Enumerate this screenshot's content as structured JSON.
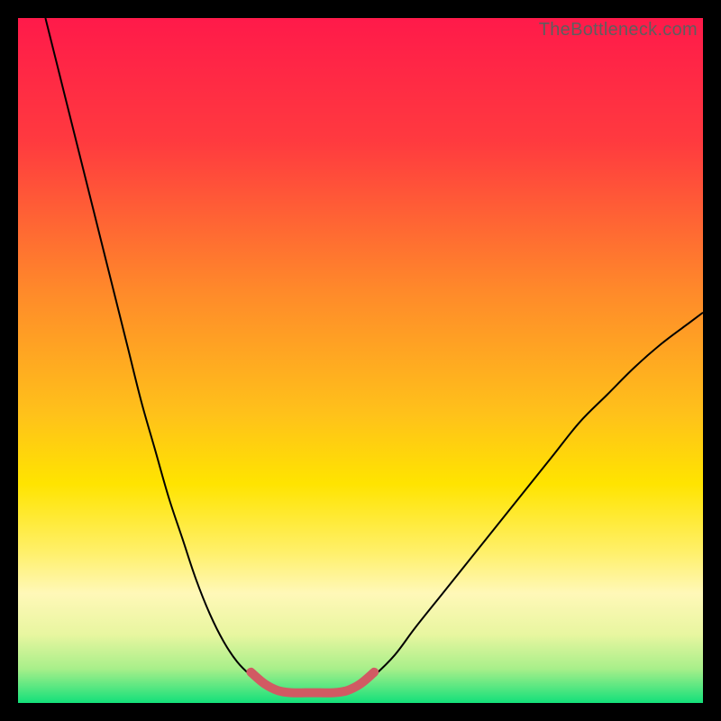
{
  "watermark": "TheBottleneck.com",
  "chart_data": {
    "type": "line",
    "title": "",
    "xlabel": "",
    "ylabel": "",
    "xlim": [
      0,
      100
    ],
    "ylim": [
      0,
      100
    ],
    "grid": false,
    "legend": false,
    "background_gradient": {
      "top_color": "#ff1a4a",
      "mid_color": "#ffe400",
      "bottom_color": "#13e07a",
      "stops": [
        {
          "pos": 0.0,
          "color": "#ff1a4a"
        },
        {
          "pos": 0.4,
          "color": "#ff8a2a"
        },
        {
          "pos": 0.68,
          "color": "#ffe400"
        },
        {
          "pos": 0.8,
          "color": "#fff59a"
        },
        {
          "pos": 0.92,
          "color": "#c9f27a"
        },
        {
          "pos": 1.0,
          "color": "#13e07a"
        }
      ]
    },
    "series": [
      {
        "name": "left-curve",
        "stroke": "#000000",
        "stroke_width": 2,
        "x": [
          4,
          6,
          8,
          10,
          12,
          14,
          16,
          18,
          20,
          22,
          24,
          26,
          28,
          30,
          32,
          34,
          36,
          38
        ],
        "y": [
          100,
          92,
          84,
          76,
          68,
          60,
          52,
          44,
          37,
          30,
          24,
          18,
          13,
          9,
          6,
          4,
          2.5,
          1.8
        ]
      },
      {
        "name": "right-curve",
        "stroke": "#000000",
        "stroke_width": 2,
        "x": [
          48,
          50,
          52,
          55,
          58,
          62,
          66,
          70,
          74,
          78,
          82,
          86,
          90,
          94,
          98,
          100
        ],
        "y": [
          1.8,
          2.5,
          4,
          7,
          11,
          16,
          21,
          26,
          31,
          36,
          41,
          45,
          49,
          52.5,
          55.5,
          57
        ]
      },
      {
        "name": "valley-highlight",
        "stroke": "#d15a63",
        "stroke_width": 10,
        "linecap": "round",
        "x": [
          34,
          36,
          38,
          40,
          42,
          44,
          46,
          48,
          50,
          52
        ],
        "y": [
          4.5,
          2.8,
          1.8,
          1.5,
          1.5,
          1.5,
          1.5,
          1.8,
          2.8,
          4.5
        ]
      }
    ],
    "annotations": []
  }
}
